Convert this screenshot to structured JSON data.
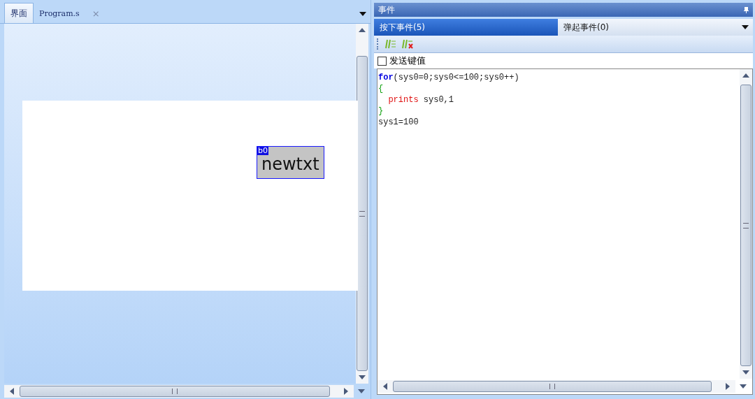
{
  "editor_tabs": [
    {
      "label": "界面",
      "selected": true
    },
    {
      "label": "Program.s",
      "selected": false,
      "close": "×"
    }
  ],
  "canvas": {
    "widgets": [
      {
        "id_label": "b0",
        "text": "newtxt",
        "selected": true
      }
    ]
  },
  "events_panel": {
    "title": "事件",
    "tabs": [
      {
        "label": "按下事件(5)",
        "selected": true
      },
      {
        "label": "弹起事件(0)",
        "selected": false
      }
    ],
    "send_key": {
      "label": "发送键值",
      "checked": false
    },
    "code": [
      [
        {
          "kind": "keyword",
          "text": "for"
        },
        {
          "kind": "plain",
          "text": "(sys0=0;sys0<=100;sys0++)"
        }
      ],
      [
        {
          "kind": "brace",
          "text": "{"
        }
      ],
      [
        {
          "kind": "function",
          "text": "  prints"
        },
        {
          "kind": "plain",
          "text": " sys0,1"
        }
      ],
      [
        {
          "kind": "brace",
          "text": "}"
        }
      ],
      [
        {
          "kind": "plain",
          "text": "sys1=100"
        }
      ]
    ]
  }
}
